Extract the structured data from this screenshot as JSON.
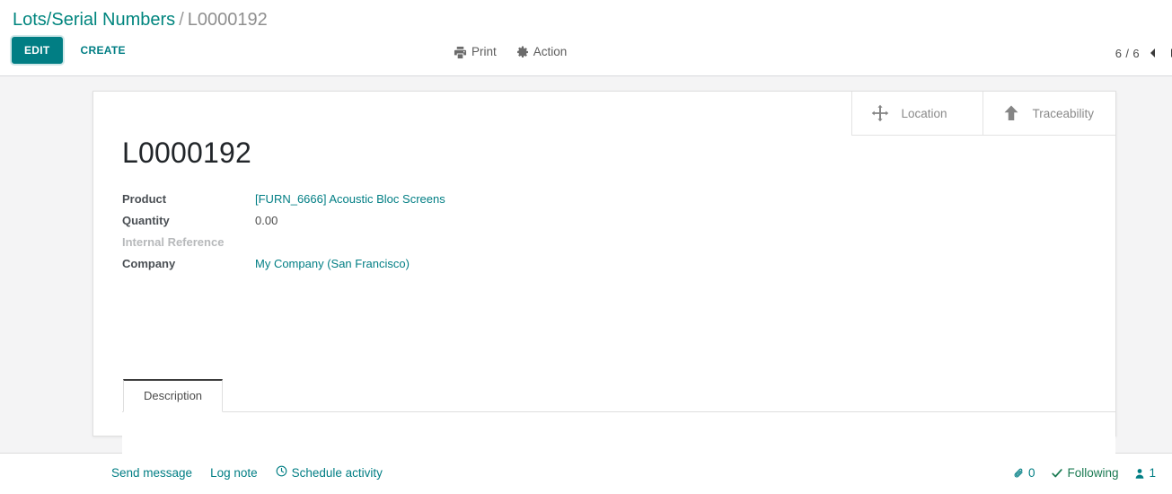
{
  "breadcrumb": {
    "root_label": "Lots/Serial Numbers",
    "separator": "/",
    "current_label": "L0000192"
  },
  "control_panel": {
    "edit_label": "EDIT",
    "create_label": "CREATE",
    "print_label": "Print",
    "print_icon": "printer-icon",
    "action_label": "Action",
    "action_icon": "gear-icon",
    "pager_value": "6 / 6",
    "pager_prev_icon": "chevron-left-icon"
  },
  "smart_buttons": [
    {
      "label": "Location",
      "icon": "arrows-move-icon"
    },
    {
      "label": "Traceability",
      "icon": "arrow-up-icon"
    }
  ],
  "record": {
    "title": "L0000192",
    "fields": [
      {
        "label": "Product",
        "value": "[FURN_6666] Acoustic Bloc Screens",
        "style": "link"
      },
      {
        "label": "Quantity",
        "value": "0.00",
        "style": "text"
      },
      {
        "label": "Internal Reference",
        "value": "",
        "style": "empty"
      },
      {
        "label": "Company",
        "value": "My Company (San Francisco)",
        "style": "link"
      }
    ]
  },
  "notebook": {
    "tabs": [
      {
        "label": "Description",
        "active": true
      }
    ],
    "page_content": ""
  },
  "chatter": {
    "send_message_label": "Send message",
    "log_note_label": "Log note",
    "schedule_activity_label": "Schedule activity",
    "schedule_activity_icon": "clock-icon",
    "attachment_icon": "paperclip-icon",
    "attachment_count": "0",
    "following_icon": "check-icon",
    "following_label": "Following",
    "followers_icon": "user-icon",
    "followers_count": "1"
  },
  "colors": {
    "accent": "#017e84",
    "link": "#017e84",
    "following_green": "#1a7a52",
    "form_bg": "#f4f4f5",
    "muted": "#b7b9bb"
  }
}
